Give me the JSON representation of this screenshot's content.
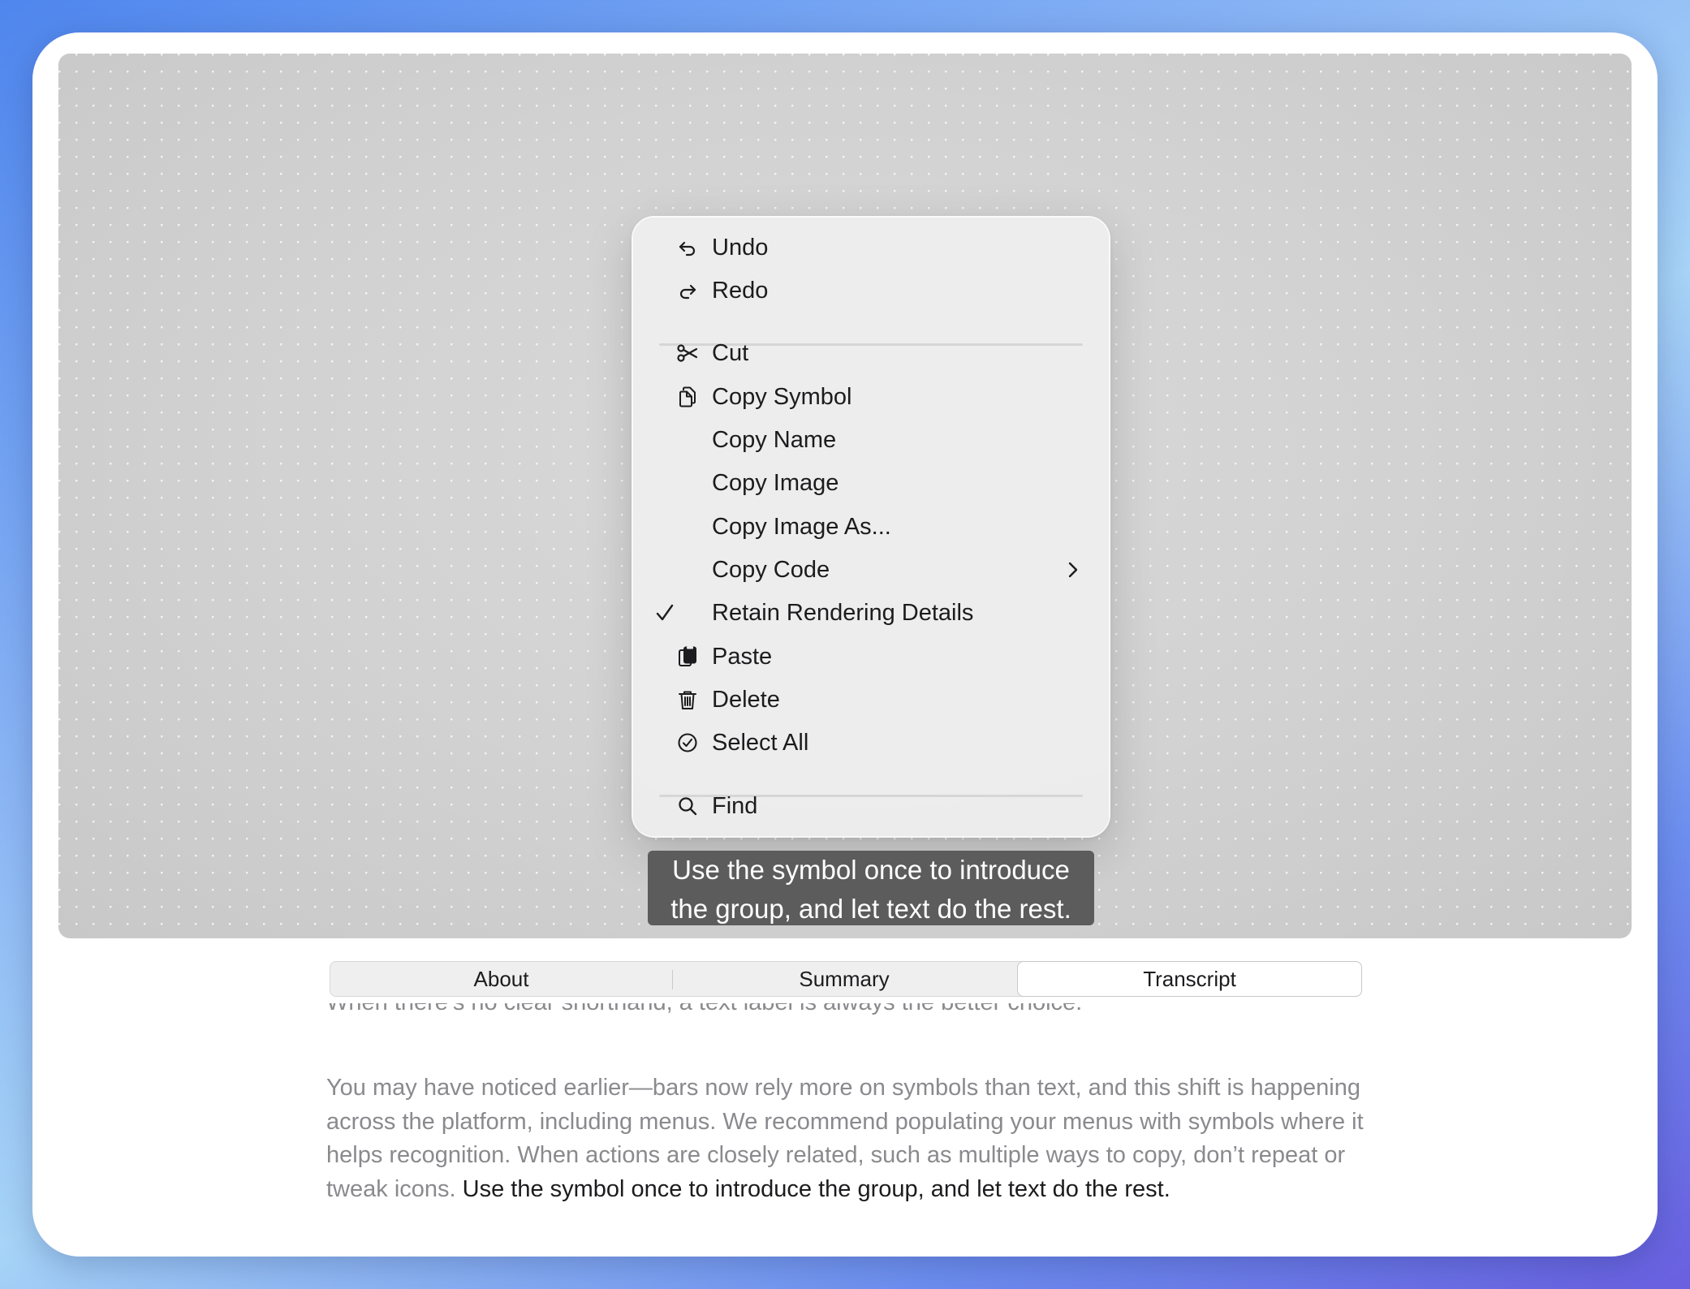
{
  "menu": {
    "items": [
      {
        "label": "Undo",
        "icon": "undo-icon"
      },
      {
        "label": "Redo",
        "icon": "redo-icon"
      },
      {
        "label": "Cut",
        "icon": "scissors-icon"
      },
      {
        "label": "Copy Symbol",
        "icon": "copy-icon"
      },
      {
        "label": "Copy Name"
      },
      {
        "label": "Copy Image"
      },
      {
        "label": "Copy Image As..."
      },
      {
        "label": "Copy Code",
        "submenu": true
      },
      {
        "label": "Retain Rendering Details",
        "checked": true
      },
      {
        "label": "Paste",
        "icon": "paste-icon"
      },
      {
        "label": "Delete",
        "icon": "trash-icon"
      },
      {
        "label": "Select All",
        "icon": "checkmark-circle-icon"
      },
      {
        "label": "Find",
        "icon": "magnifying-glass-icon"
      }
    ]
  },
  "tooltip": {
    "line1": "Use the symbol once to introduce",
    "line2": "the group, and let text do the rest."
  },
  "tabs": {
    "items": [
      "About",
      "Summary",
      "Transcript"
    ],
    "selected": "Transcript"
  },
  "transcript": {
    "cut_line": "When there’s no clear shorthand, a text label is always the better choice.",
    "paragraph_muted": "You may have noticed earlier—bars now rely more on symbols than text, and this shift is happening across the platform, including menus. We recommend populating your menus with symbols where it helps recognition. When actions are closely related, such as multiple ways to copy, don’t repeat or tweak icons. ",
    "paragraph_highlight": "Use the symbol once to introduce the group, and let text do the rest."
  },
  "colors": {
    "menu_background": "#ededed",
    "tooltip_background": "#5c5c5c",
    "text_primary": "#1c1c1e",
    "text_muted": "#8a8a8e"
  }
}
